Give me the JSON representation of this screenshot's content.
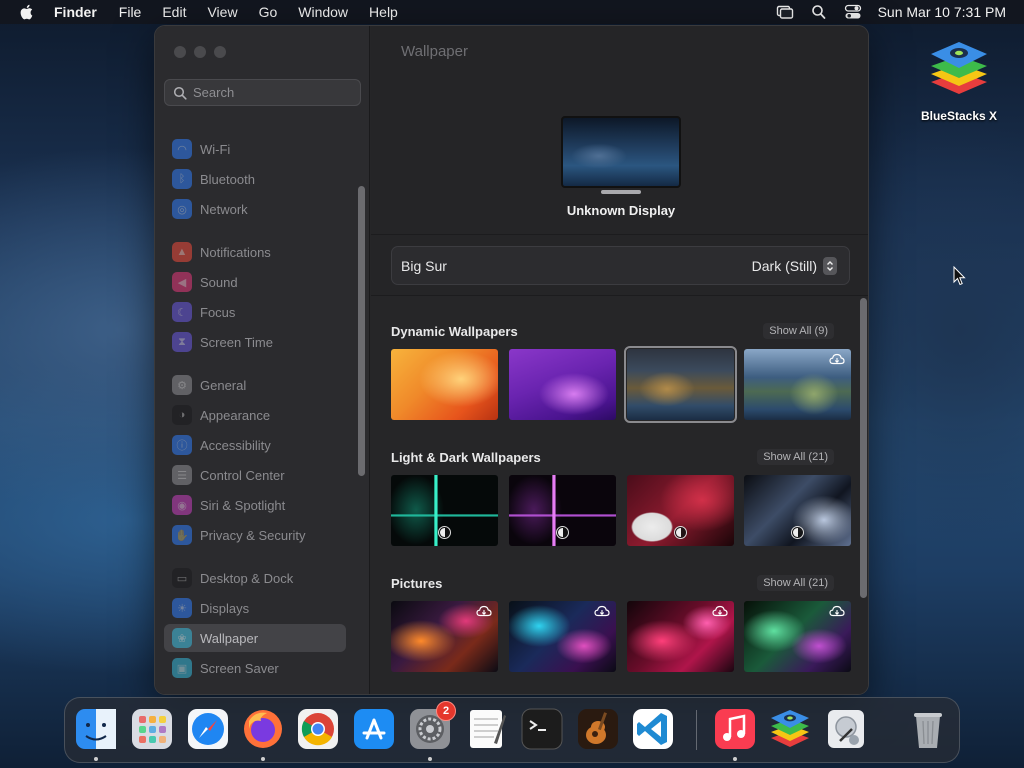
{
  "menubar": {
    "app_name": "Finder",
    "items": [
      "File",
      "Edit",
      "View",
      "Go",
      "Window",
      "Help"
    ],
    "clock": "Sun Mar 10  7:31 PM",
    "icons": [
      "apple-icon",
      "screen-mirroring-icon",
      "spotlight-search-icon",
      "control-center-icon"
    ]
  },
  "desktop": {
    "icons": [
      {
        "label": "BlueStacks X",
        "icon": "bluestacks-x-icon"
      }
    ]
  },
  "window": {
    "search": {
      "placeholder": "Search",
      "value": ""
    },
    "sidebar": {
      "items": [
        {
          "label": "Wi-Fi",
          "icon": "wifi-icon",
          "color": "#2f7cf6"
        },
        {
          "label": "Bluetooth",
          "icon": "bluetooth-icon",
          "color": "#2f7cf6"
        },
        {
          "label": "Network",
          "icon": "globe-icon",
          "color": "#2f7cf6"
        },
        {
          "label": "Notifications",
          "icon": "bell-icon",
          "color": "#ef4a3b"
        },
        {
          "label": "Sound",
          "icon": "speaker-icon",
          "color": "#e5397c"
        },
        {
          "label": "Focus",
          "icon": "moon-icon",
          "color": "#6a5ae0"
        },
        {
          "label": "Screen Time",
          "icon": "hourglass-icon",
          "color": "#6a5ae0"
        },
        {
          "label": "General",
          "icon": "gear-icon",
          "color": "#8e8e93"
        },
        {
          "label": "Appearance",
          "icon": "appearance-icon",
          "color": "#1c1c1e"
        },
        {
          "label": "Accessibility",
          "icon": "accessibility-icon",
          "color": "#2f7cf6"
        },
        {
          "label": "Control Center",
          "icon": "control-center-icon",
          "color": "#8e8e93"
        },
        {
          "label": "Siri & Spotlight",
          "icon": "siri-icon",
          "color": "#c83fbf"
        },
        {
          "label": "Privacy & Security",
          "icon": "hand-icon",
          "color": "#2f7cf6"
        },
        {
          "label": "Desktop & Dock",
          "icon": "dock-icon",
          "color": "#1c1c1e"
        },
        {
          "label": "Displays",
          "icon": "sun-icon",
          "color": "#2f7cf6"
        },
        {
          "label": "Wallpaper",
          "icon": "wallpaper-icon",
          "color": "#35b6d8",
          "active": true
        },
        {
          "label": "Screen Saver",
          "icon": "screen-saver-icon",
          "color": "#35b6d8"
        }
      ]
    },
    "main": {
      "title": "Wallpaper",
      "display_name": "Unknown Display",
      "picker": {
        "wallpaper_name": "Big Sur",
        "mode_value": "Dark (Still)"
      },
      "sections": [
        {
          "title": "Dynamic Wallpapers",
          "show_all": "Show All (9)"
        },
        {
          "title": "Light & Dark Wallpapers",
          "show_all": "Show All (21)"
        },
        {
          "title": "Pictures",
          "show_all": "Show All (21)"
        }
      ]
    }
  },
  "dock": {
    "apps": [
      {
        "name": "Finder",
        "icon": "finder-icon",
        "running": true
      },
      {
        "name": "Launchpad",
        "icon": "launchpad-icon",
        "running": false
      },
      {
        "name": "Safari",
        "icon": "safari-icon",
        "running": false
      },
      {
        "name": "Firefox",
        "icon": "firefox-icon",
        "running": true
      },
      {
        "name": "Chrome",
        "icon": "chrome-icon",
        "running": false
      },
      {
        "name": "App Store",
        "icon": "app-store-icon",
        "running": false
      },
      {
        "name": "System Settings",
        "icon": "system-settings-icon",
        "running": true,
        "badge": "2"
      },
      {
        "name": "TextEdit",
        "icon": "textedit-icon",
        "running": false
      },
      {
        "name": "Terminal",
        "icon": "terminal-icon",
        "running": false
      },
      {
        "name": "GarageBand",
        "icon": "garageband-icon",
        "running": false
      },
      {
        "name": "Visual Studio Code",
        "icon": "vscode-icon",
        "running": false
      },
      {
        "name": "Music",
        "icon": "music-icon",
        "running": true
      },
      {
        "name": "BlueStacks",
        "icon": "bluestacks-icon",
        "running": false
      },
      {
        "name": "Disk Utility",
        "icon": "disk-utility-icon",
        "running": false
      },
      {
        "name": "Trash",
        "icon": "trash-icon",
        "running": false
      }
    ]
  }
}
